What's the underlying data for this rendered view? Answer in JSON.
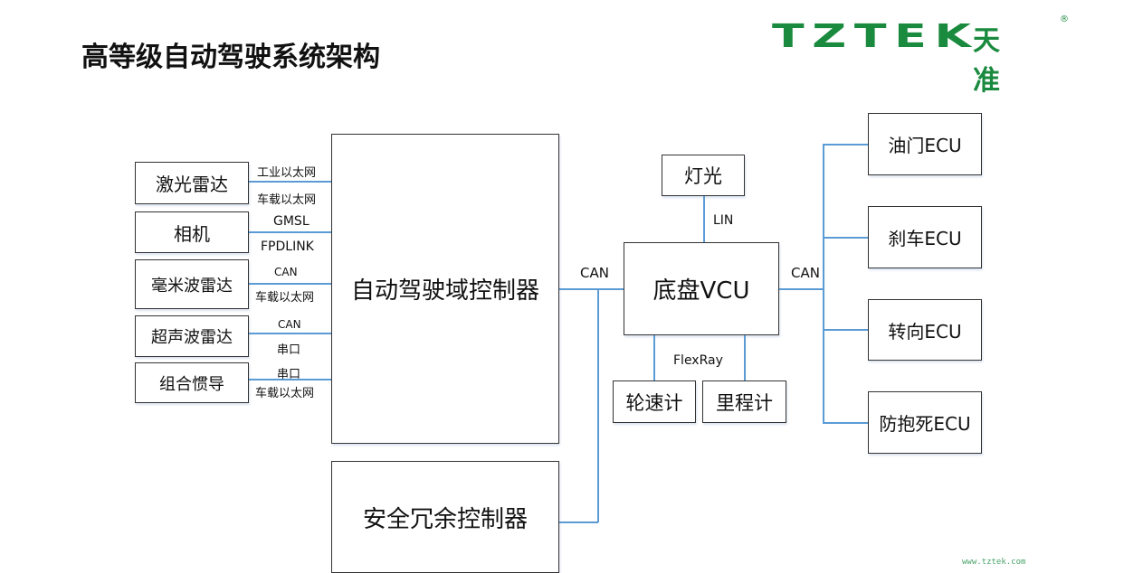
{
  "header": {
    "title": "高等级自动驾驶系统架构",
    "logo_en": "TZTEK",
    "logo_cn": "天准",
    "logo_reg": "®"
  },
  "sensors": [
    {
      "label": "激光雷达",
      "top_link": "工业以太网",
      "bottom_link": "车载以太网"
    },
    {
      "label": "相机",
      "top_link": "GMSL",
      "bottom_link": "FPDLINK"
    },
    {
      "label": "毫米波雷达",
      "top_link": "CAN",
      "bottom_link": "车载以太网"
    },
    {
      "label": "超声波雷达",
      "top_link": "CAN",
      "bottom_link": "串口"
    },
    {
      "label": "组合惯导",
      "top_link": "串口",
      "bottom_link": "车载以太网"
    }
  ],
  "controllers": {
    "ad_domain": "自动驾驶域控制器",
    "safety": "安全冗余控制器"
  },
  "chassis": {
    "vcu": "底盘VCU",
    "left_bus": "CAN",
    "right_bus": "CAN",
    "light": "灯光",
    "light_bus": "LIN",
    "flexray_bus": "FlexRay",
    "wheel_speed": "轮速计",
    "odometer": "里程计"
  },
  "ecus": [
    "油门ECU",
    "刹车ECU",
    "转向ECU",
    "防抱死ECU"
  ],
  "footer": {
    "url": "www.tztek.com"
  },
  "colors": {
    "brand_green": "#1a8a3e",
    "link_blue": "#5b9bd5",
    "box_border": "#333333"
  }
}
